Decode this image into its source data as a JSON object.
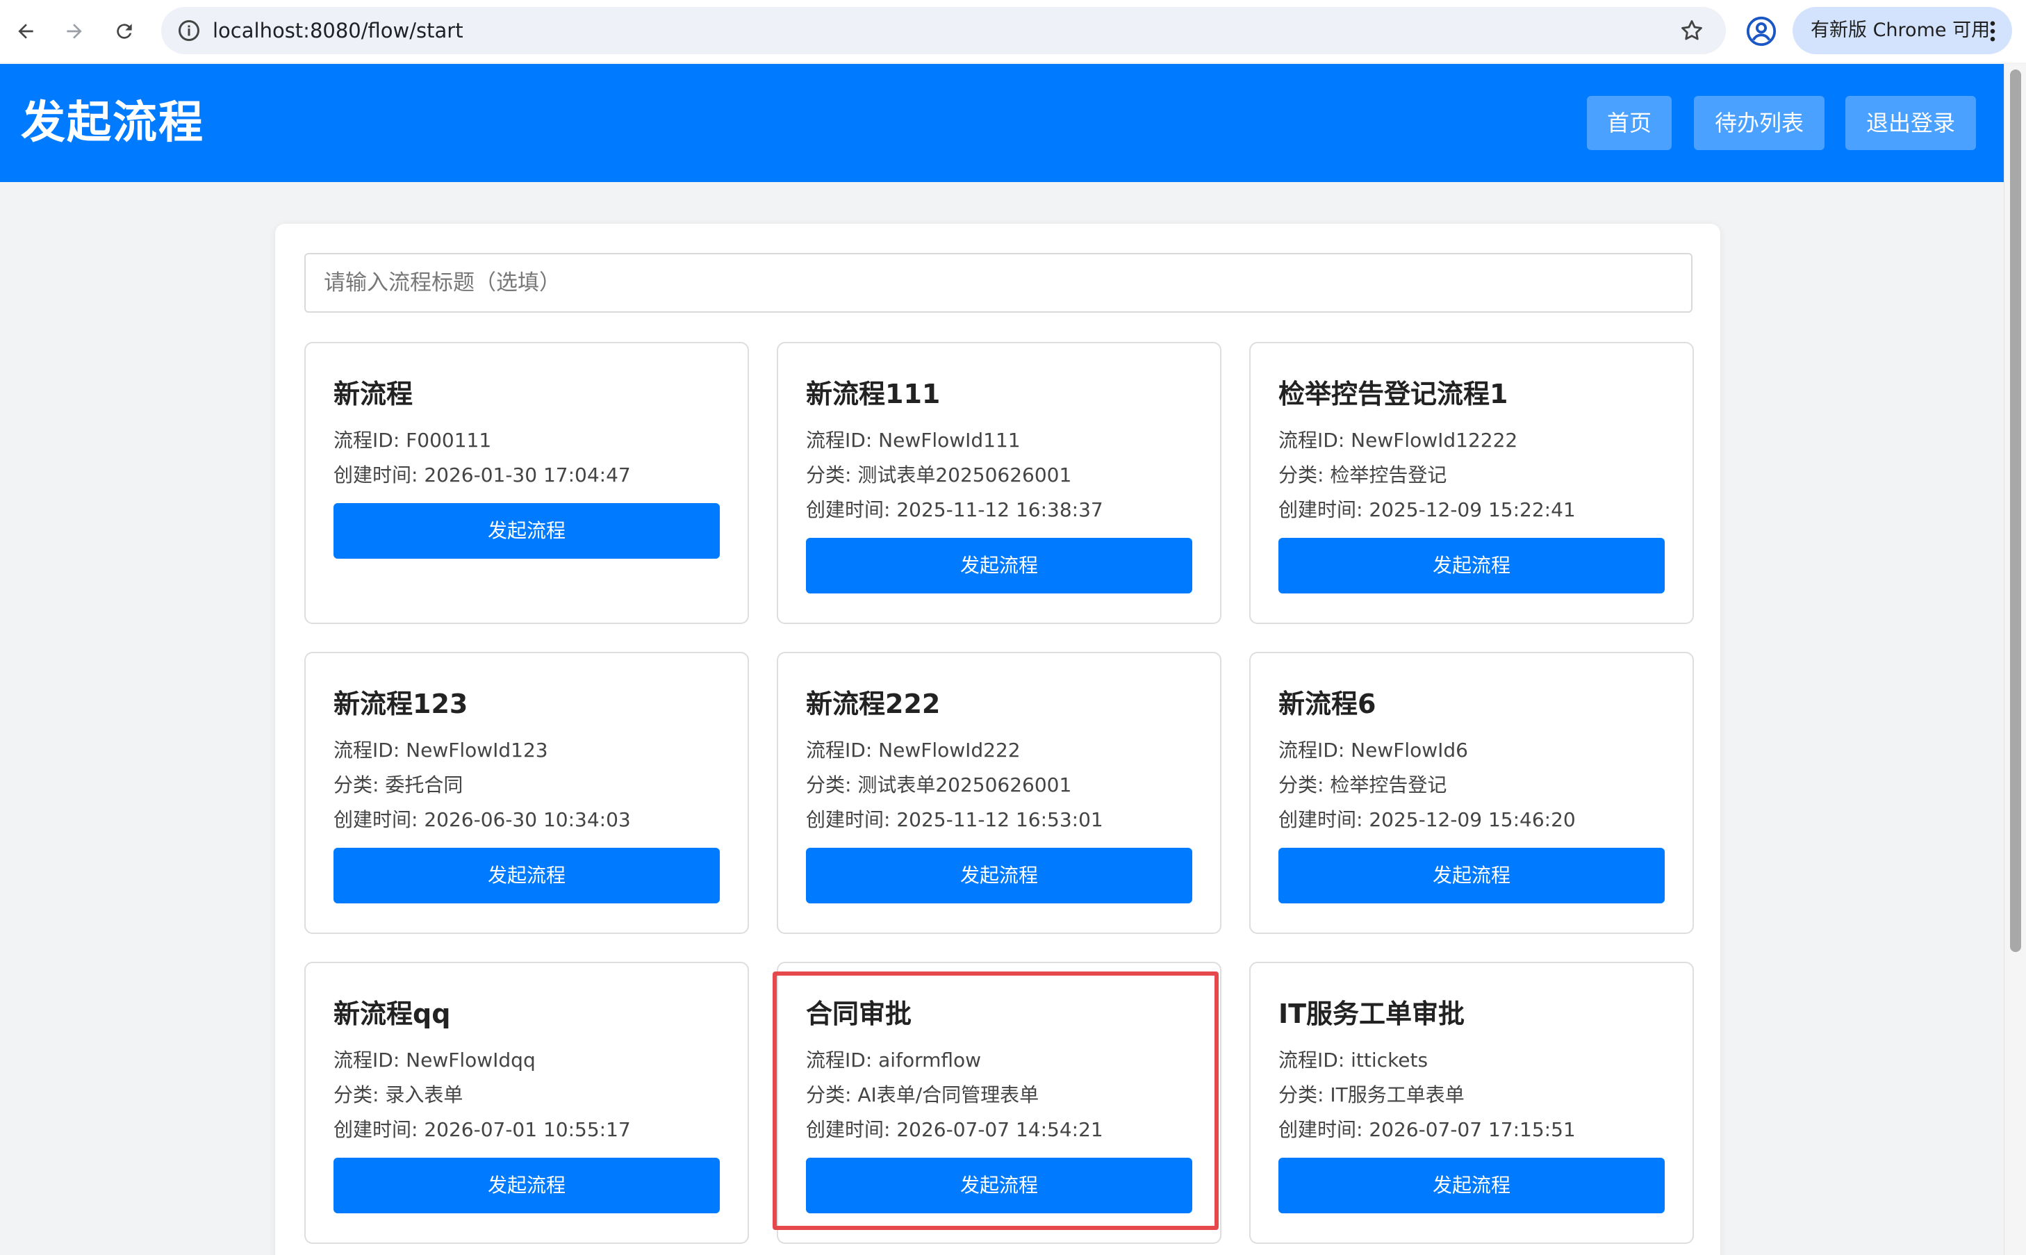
{
  "browser": {
    "url": "localhost:8080/flow/start",
    "update_label": "有新版 Chrome 可用",
    "icons": [
      "back-arrow-icon",
      "forward-arrow-icon",
      "reload-icon",
      "site-info-icon",
      "bookmark-star-icon",
      "profile-icon",
      "kebab-menu-icon"
    ]
  },
  "header": {
    "title": "发起流程",
    "buttons": [
      "首页",
      "待办列表",
      "退出登录"
    ]
  },
  "search": {
    "placeholder": "请输入流程标题（选填）"
  },
  "colors": {
    "primary": "#007bff",
    "header_button": "#4aa1ff",
    "highlight": "#e5484d"
  },
  "cards": [
    {
      "title": "新流程",
      "id": "流程ID: F000111",
      "category": "",
      "created": "创建时间: 2026-01-30 17:04:47",
      "button": "发起流程"
    },
    {
      "title": "新流程111",
      "id": "流程ID: NewFlowId111",
      "category": "分类: 测试表单20250626001",
      "created": "创建时间: 2025-11-12 16:38:37",
      "button": "发起流程"
    },
    {
      "title": "检举控告登记流程1",
      "id": "流程ID: NewFlowId12222",
      "category": "分类: 检举控告登记",
      "created": "创建时间: 2025-12-09 15:22:41",
      "button": "发起流程"
    },
    {
      "title": "新流程123",
      "id": "流程ID: NewFlowId123",
      "category": "分类: 委托合同",
      "created": "创建时间: 2026-06-30 10:34:03",
      "button": "发起流程"
    },
    {
      "title": "新流程222",
      "id": "流程ID: NewFlowId222",
      "category": "分类: 测试表单20250626001",
      "created": "创建时间: 2025-11-12 16:53:01",
      "button": "发起流程"
    },
    {
      "title": "新流程6",
      "id": "流程ID: NewFlowId6",
      "category": "分类: 检举控告登记",
      "created": "创建时间: 2025-12-09 15:46:20",
      "button": "发起流程"
    },
    {
      "title": "新流程qq",
      "id": "流程ID: NewFlowIdqq",
      "category": "分类: 录入表单",
      "created": "创建时间: 2026-07-01 10:55:17",
      "button": "发起流程"
    },
    {
      "title": "合同审批",
      "id": "流程ID: aiformflow",
      "category": "分类: AI表单/合同管理表单",
      "created": "创建时间: 2026-07-07 14:54:21",
      "button": "发起流程"
    },
    {
      "title": "IT服务工单审批",
      "id": "流程ID: ittickets",
      "category": "分类: IT服务工单表单",
      "created": "创建时间: 2026-07-07 17:15:51",
      "button": "发起流程"
    }
  ]
}
